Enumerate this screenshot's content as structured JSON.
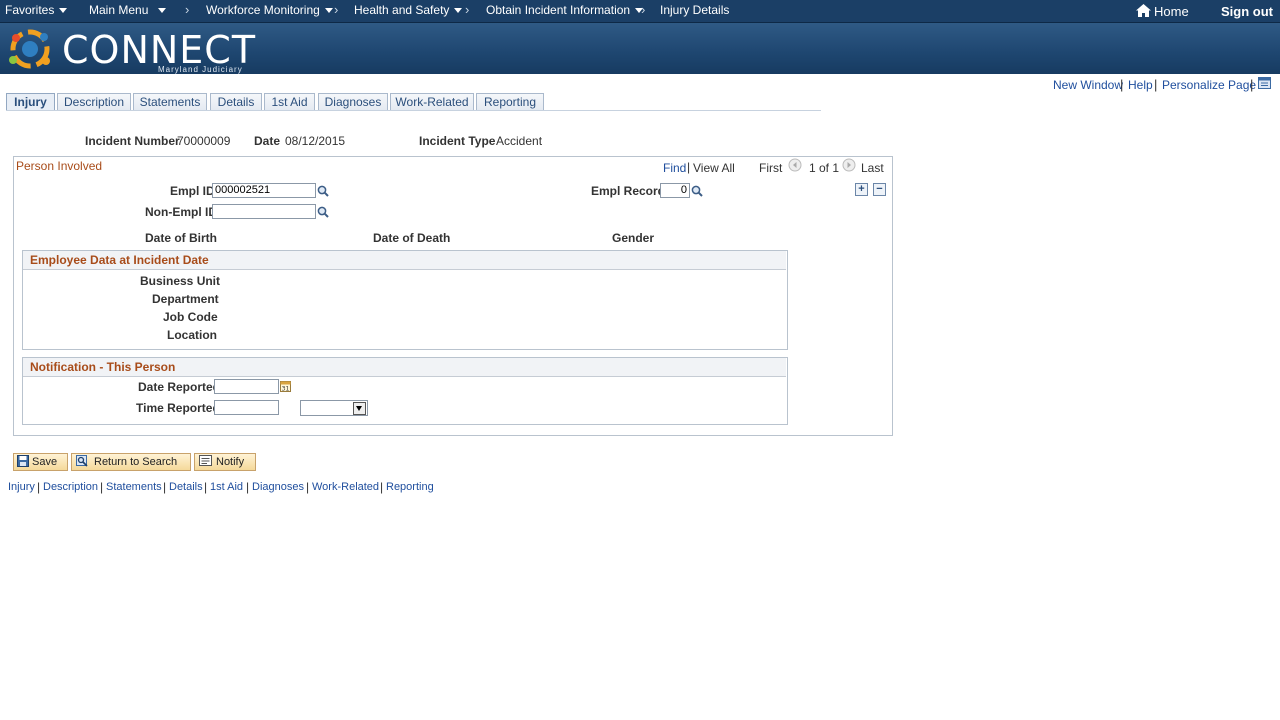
{
  "nav": {
    "favorites": "Favorites",
    "main_menu": "Main Menu",
    "workforce_monitoring": "Workforce Monitoring",
    "health_safety": "Health and Safety",
    "obtain_incident": "Obtain Incident Information",
    "injury_details": "Injury Details",
    "home": "Home",
    "sign_out": "Sign out"
  },
  "brand": {
    "name": "CONNECT",
    "sub": "Maryland Judiciary"
  },
  "util": {
    "new_window": "New Window",
    "help": "Help",
    "personalize": "Personalize Page"
  },
  "tabs": [
    "Injury",
    "Description",
    "Statements",
    "Details",
    "1st Aid",
    "Diagnoses",
    "Work-Related",
    "Reporting"
  ],
  "header": {
    "incident_number_label": "Incident Number",
    "incident_number": "70000009",
    "date_label": "Date",
    "date": "08/12/2015",
    "incident_type_label": "Incident Type",
    "incident_type": "Accident"
  },
  "person": {
    "title": "Person Involved",
    "find": "Find",
    "view_all": "View All",
    "first": "First",
    "count": "1 of 1",
    "last": "Last",
    "empl_id_label": "Empl ID",
    "empl_id": "000002521",
    "empl_record_label": "Empl Record",
    "empl_record": "0",
    "non_empl_id_label": "Non-Empl ID",
    "non_empl_id": "",
    "dob_label": "Date of Birth",
    "dod_label": "Date of Death",
    "gender_label": "Gender"
  },
  "employee_data": {
    "title": "Employee Data at Incident Date",
    "business_unit": "Business Unit",
    "department": "Department",
    "job_code": "Job Code",
    "location": "Location"
  },
  "notification": {
    "title": "Notification - This Person",
    "date_reported": "Date Reported",
    "time_reported": "Time Reported",
    "date_value": "",
    "time_value": "",
    "ampm_value": ""
  },
  "buttons": {
    "save": "Save",
    "return": "Return to Search",
    "notify": "Notify"
  },
  "footer_links": [
    "Injury",
    "Description",
    "Statements",
    "Details",
    "1st Aid",
    "Diagnoses",
    "Work-Related",
    "Reporting"
  ],
  "colors": {
    "nav_bg": "#1b3f66",
    "section_title": "#a84c1a",
    "link": "#1f4e9d"
  }
}
